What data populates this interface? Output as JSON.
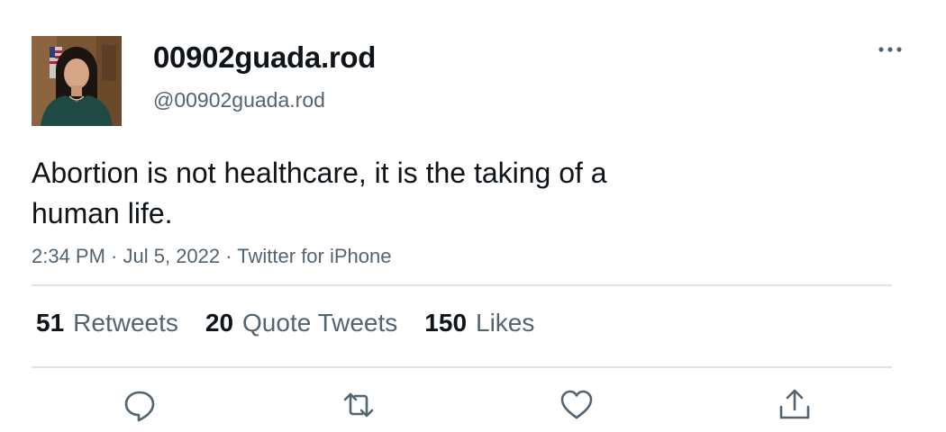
{
  "user": {
    "display_name": "00902guada.rod",
    "handle": "@00902guada.rod",
    "avatar_icon": "profile-photo"
  },
  "tweet": {
    "text": "Abortion is not healthcare, it is the taking of a human life.",
    "time": "2:34 PM",
    "separator": " · ",
    "date": "Jul 5, 2022",
    "source": "Twitter for iPhone"
  },
  "stats": {
    "retweets_count": "51",
    "retweets_label": "Retweets",
    "quotes_count": "20",
    "quotes_label": "Quote Tweets",
    "likes_count": "150",
    "likes_label": "Likes"
  },
  "actions": {
    "reply_icon": "reply-icon",
    "retweet_icon": "retweet-icon",
    "like_icon": "like-icon",
    "share_icon": "share-icon",
    "more_icon": "more-icon"
  },
  "colors": {
    "primary_text": "#0f1419",
    "secondary_text": "#536471",
    "divider": "#dfe3e6",
    "icon": "#536471"
  }
}
